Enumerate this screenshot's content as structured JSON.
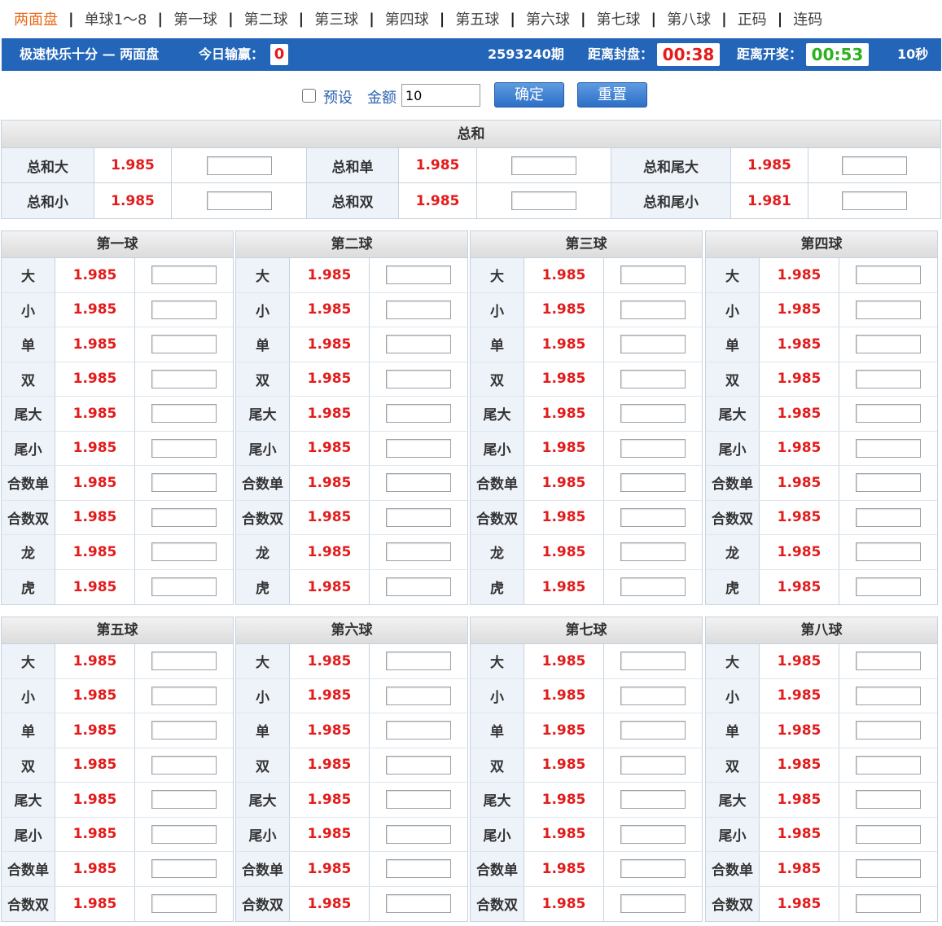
{
  "nav": {
    "tabs": [
      "两面盘",
      "单球1～8",
      "第一球",
      "第二球",
      "第三球",
      "第四球",
      "第五球",
      "第六球",
      "第七球",
      "第八球",
      "正码",
      "连码"
    ],
    "separator": "|",
    "active_index": 0
  },
  "info": {
    "game_title": "极速快乐十分 — 两面盘",
    "profit_label": "今日输赢：",
    "profit_value": "0",
    "period": "2593240期",
    "close_label": "距离封盘：",
    "close_time": "00:38",
    "draw_label": "距离开奖：",
    "draw_time": "00:53",
    "refresh": "10秒"
  },
  "controls": {
    "preset_label": "预设",
    "amount_label": "金额",
    "amount_value": "10",
    "confirm_label": "确定",
    "reset_label": "重置"
  },
  "total": {
    "title": "总和",
    "rows": [
      [
        {
          "label": "总和大",
          "odds": "1.985"
        },
        {
          "label": "总和单",
          "odds": "1.985"
        },
        {
          "label": "总和尾大",
          "odds": "1.985"
        }
      ],
      [
        {
          "label": "总和小",
          "odds": "1.985"
        },
        {
          "label": "总和双",
          "odds": "1.985"
        },
        {
          "label": "总和尾小",
          "odds": "1.981"
        }
      ]
    ]
  },
  "balls_group1": [
    {
      "title": "第一球",
      "rows": [
        {
          "label": "大",
          "odds": "1.985"
        },
        {
          "label": "小",
          "odds": "1.985"
        },
        {
          "label": "单",
          "odds": "1.985"
        },
        {
          "label": "双",
          "odds": "1.985"
        },
        {
          "label": "尾大",
          "odds": "1.985"
        },
        {
          "label": "尾小",
          "odds": "1.985"
        },
        {
          "label": "合数单",
          "odds": "1.985"
        },
        {
          "label": "合数双",
          "odds": "1.985"
        },
        {
          "label": "龙",
          "odds": "1.985"
        },
        {
          "label": "虎",
          "odds": "1.985"
        }
      ]
    },
    {
      "title": "第二球",
      "rows": [
        {
          "label": "大",
          "odds": "1.985"
        },
        {
          "label": "小",
          "odds": "1.985"
        },
        {
          "label": "单",
          "odds": "1.985"
        },
        {
          "label": "双",
          "odds": "1.985"
        },
        {
          "label": "尾大",
          "odds": "1.985"
        },
        {
          "label": "尾小",
          "odds": "1.985"
        },
        {
          "label": "合数单",
          "odds": "1.985"
        },
        {
          "label": "合数双",
          "odds": "1.985"
        },
        {
          "label": "龙",
          "odds": "1.985"
        },
        {
          "label": "虎",
          "odds": "1.985"
        }
      ]
    },
    {
      "title": "第三球",
      "rows": [
        {
          "label": "大",
          "odds": "1.985"
        },
        {
          "label": "小",
          "odds": "1.985"
        },
        {
          "label": "单",
          "odds": "1.985"
        },
        {
          "label": "双",
          "odds": "1.985"
        },
        {
          "label": "尾大",
          "odds": "1.985"
        },
        {
          "label": "尾小",
          "odds": "1.985"
        },
        {
          "label": "合数单",
          "odds": "1.985"
        },
        {
          "label": "合数双",
          "odds": "1.985"
        },
        {
          "label": "龙",
          "odds": "1.985"
        },
        {
          "label": "虎",
          "odds": "1.985"
        }
      ]
    },
    {
      "title": "第四球",
      "rows": [
        {
          "label": "大",
          "odds": "1.985"
        },
        {
          "label": "小",
          "odds": "1.985"
        },
        {
          "label": "单",
          "odds": "1.985"
        },
        {
          "label": "双",
          "odds": "1.985"
        },
        {
          "label": "尾大",
          "odds": "1.985"
        },
        {
          "label": "尾小",
          "odds": "1.985"
        },
        {
          "label": "合数单",
          "odds": "1.985"
        },
        {
          "label": "合数双",
          "odds": "1.985"
        },
        {
          "label": "龙",
          "odds": "1.985"
        },
        {
          "label": "虎",
          "odds": "1.985"
        }
      ]
    }
  ],
  "balls_group2": [
    {
      "title": "第五球",
      "rows": [
        {
          "label": "大",
          "odds": "1.985"
        },
        {
          "label": "小",
          "odds": "1.985"
        },
        {
          "label": "单",
          "odds": "1.985"
        },
        {
          "label": "双",
          "odds": "1.985"
        },
        {
          "label": "尾大",
          "odds": "1.985"
        },
        {
          "label": "尾小",
          "odds": "1.985"
        },
        {
          "label": "合数单",
          "odds": "1.985"
        },
        {
          "label": "合数双",
          "odds": "1.985"
        }
      ]
    },
    {
      "title": "第六球",
      "rows": [
        {
          "label": "大",
          "odds": "1.985"
        },
        {
          "label": "小",
          "odds": "1.985"
        },
        {
          "label": "单",
          "odds": "1.985"
        },
        {
          "label": "双",
          "odds": "1.985"
        },
        {
          "label": "尾大",
          "odds": "1.985"
        },
        {
          "label": "尾小",
          "odds": "1.985"
        },
        {
          "label": "合数单",
          "odds": "1.985"
        },
        {
          "label": "合数双",
          "odds": "1.985"
        }
      ]
    },
    {
      "title": "第七球",
      "rows": [
        {
          "label": "大",
          "odds": "1.985"
        },
        {
          "label": "小",
          "odds": "1.985"
        },
        {
          "label": "单",
          "odds": "1.985"
        },
        {
          "label": "双",
          "odds": "1.985"
        },
        {
          "label": "尾大",
          "odds": "1.985"
        },
        {
          "label": "尾小",
          "odds": "1.985"
        },
        {
          "label": "合数单",
          "odds": "1.985"
        },
        {
          "label": "合数双",
          "odds": "1.985"
        }
      ]
    },
    {
      "title": "第八球",
      "rows": [
        {
          "label": "大",
          "odds": "1.985"
        },
        {
          "label": "小",
          "odds": "1.985"
        },
        {
          "label": "单",
          "odds": "1.985"
        },
        {
          "label": "双",
          "odds": "1.985"
        },
        {
          "label": "尾大",
          "odds": "1.985"
        },
        {
          "label": "尾小",
          "odds": "1.985"
        },
        {
          "label": "合数单",
          "odds": "1.985"
        },
        {
          "label": "合数双",
          "odds": "1.985"
        }
      ]
    }
  ]
}
